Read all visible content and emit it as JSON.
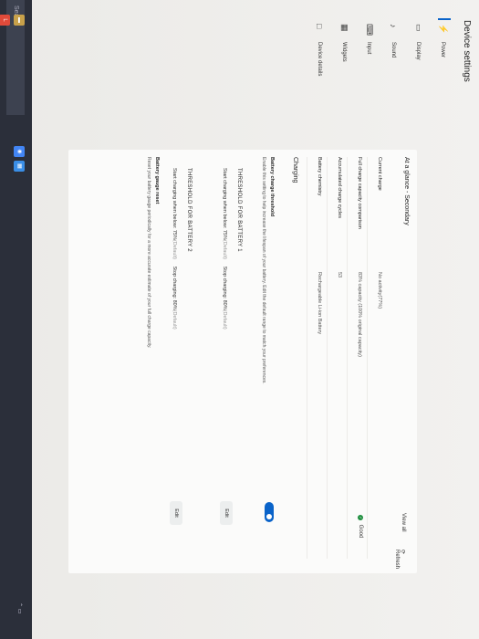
{
  "app": {
    "title": "Device settings"
  },
  "sidebar": {
    "items": [
      {
        "label": "Power",
        "icon": "lightning-icon"
      },
      {
        "label": "Display",
        "icon": "monitor-icon"
      },
      {
        "label": "Sound",
        "icon": "music-note-icon"
      },
      {
        "label": "Input",
        "icon": "keyboard-icon"
      },
      {
        "label": "Widgets",
        "icon": "grid-icon"
      },
      {
        "label": "Device details",
        "icon": "device-icon"
      }
    ]
  },
  "glance": {
    "title": "At a glance - Secondary",
    "view_all": "View all",
    "refresh": "Refresh",
    "rows": [
      {
        "label": "Current charge",
        "value": "No activity(77%)",
        "status": ""
      },
      {
        "label": "Full charge capacity comparison",
        "value": "83% capacity (100% original capacity)",
        "status": "Good"
      },
      {
        "label": "Accumulated charge cycles",
        "value": "53",
        "status": ""
      },
      {
        "label": "Battery chemistry",
        "value": "Rechargeable Li-ion Battery",
        "status": ""
      }
    ]
  },
  "charging": {
    "title": "Charging",
    "threshold_title": "Battery charge threshold",
    "threshold_desc": "Enable this setting to help increase the lifespan of your battery. Edit the default range to match your preferences.",
    "battery1_title": "THRESHOLD FOR BATTERY 1",
    "battery1_start": "Start charging when below: 75%",
    "battery1_start_default": "(Default)",
    "battery1_stop": "Stop charging: 80%",
    "battery1_stop_default": "(Default)",
    "battery2_title": "THRESHOLD FOR BATTERY 2",
    "battery2_start": "Start charging when below: 75%",
    "battery2_start_default": "(Default)",
    "battery2_stop": "Stop charging: 80%",
    "battery2_stop_default": "(Default)",
    "edit_label": "Edit",
    "reset_title": "Battery gauge reset",
    "reset_desc": "Reset your battery gauge periodically for a more accurate estimate of your full charge capacity."
  },
  "taskbar": {
    "search": "Search"
  },
  "colors": {
    "accent": "#0a63c9",
    "good": "#1e8e3e"
  }
}
